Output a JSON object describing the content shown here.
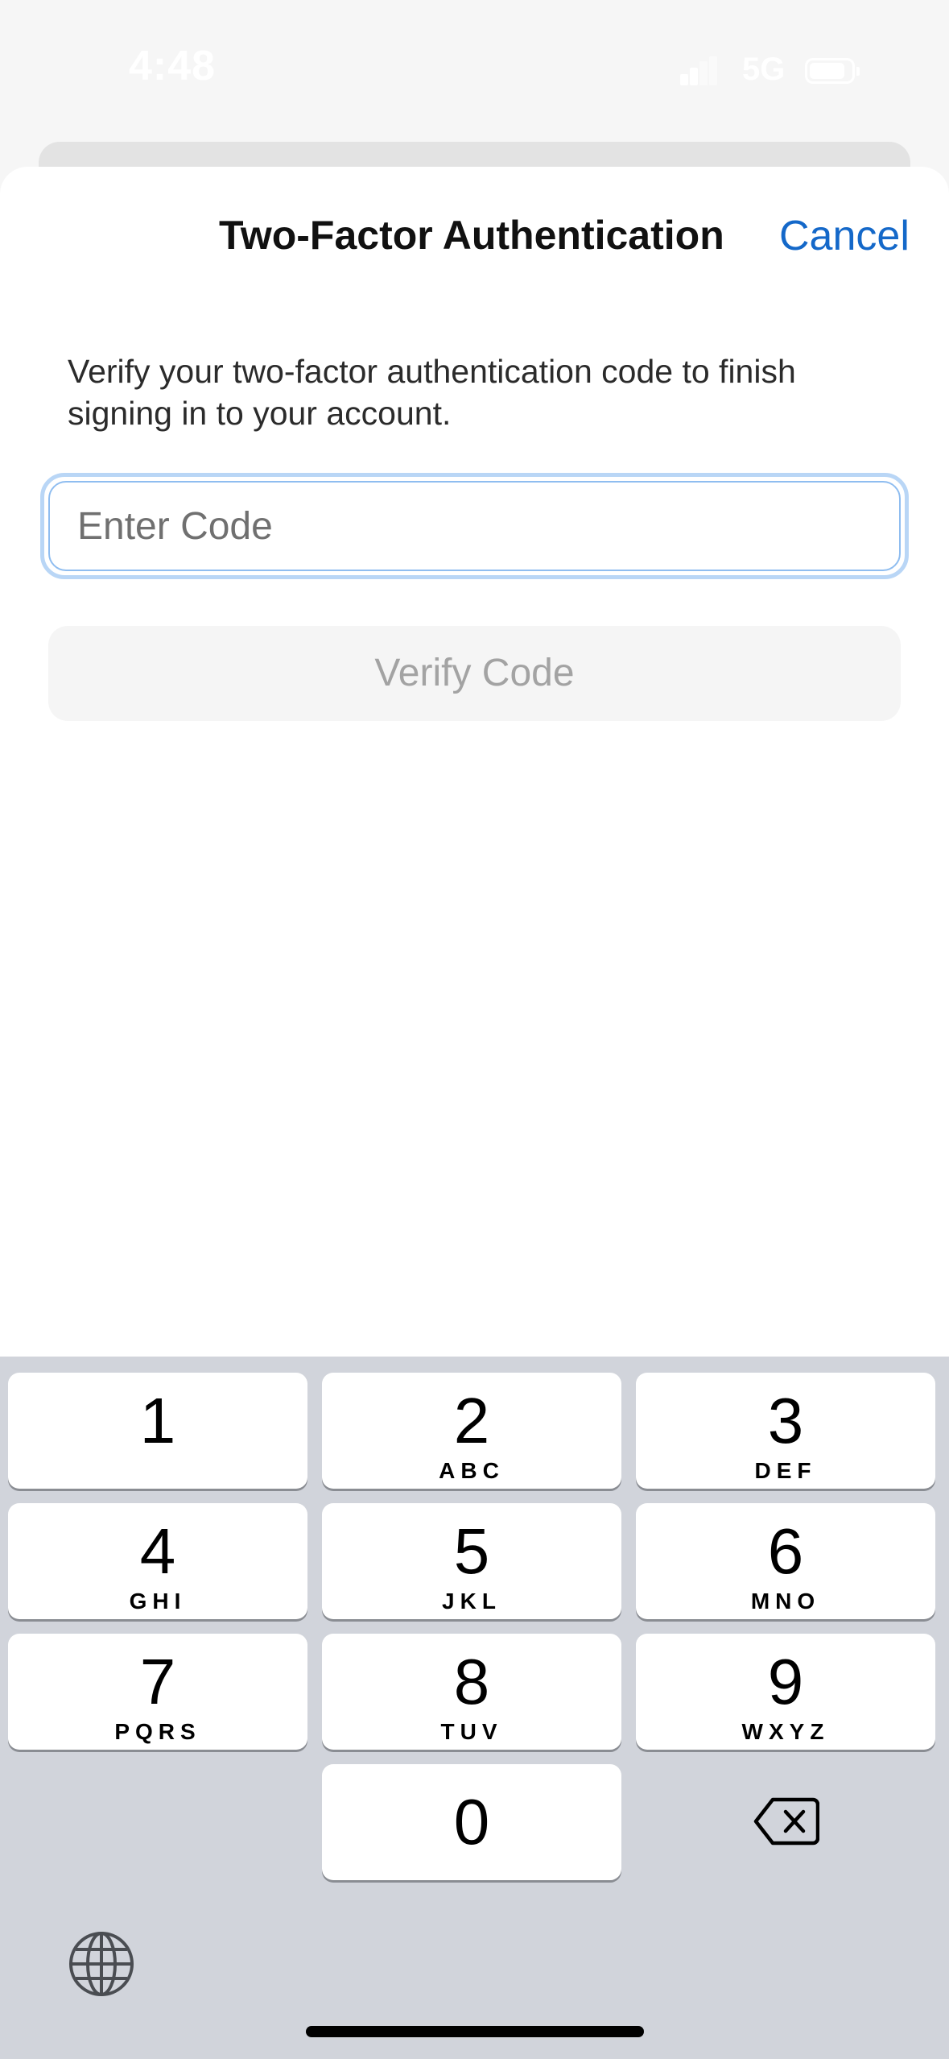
{
  "status_bar": {
    "time": "4:48",
    "network": "5G",
    "signal_icon": "cellular-signal-icon",
    "battery_icon": "battery-icon"
  },
  "sheet": {
    "title": "Two-Factor Authentication",
    "cancel_label": "Cancel",
    "description": "Verify your two-factor authentication code to finish signing in to your account.",
    "code_input": {
      "value": "",
      "placeholder": "Enter Code"
    },
    "verify_label": "Verify Code"
  },
  "keypad": {
    "keys": [
      {
        "digit": "1",
        "letters": ""
      },
      {
        "digit": "2",
        "letters": "ABC"
      },
      {
        "digit": "3",
        "letters": "DEF"
      },
      {
        "digit": "4",
        "letters": "GHI"
      },
      {
        "digit": "5",
        "letters": "JKL"
      },
      {
        "digit": "6",
        "letters": "MNO"
      },
      {
        "digit": "7",
        "letters": "PQRS"
      },
      {
        "digit": "8",
        "letters": "TUV"
      },
      {
        "digit": "9",
        "letters": "WXYZ"
      },
      {
        "digit": "0",
        "letters": ""
      }
    ],
    "delete_icon": "backspace-icon",
    "globe_icon": "globe-icon"
  },
  "colors": {
    "accent": "#1468c9",
    "keyboard_bg": "#d1d4db",
    "focus_ring": "#b9d6f6"
  }
}
